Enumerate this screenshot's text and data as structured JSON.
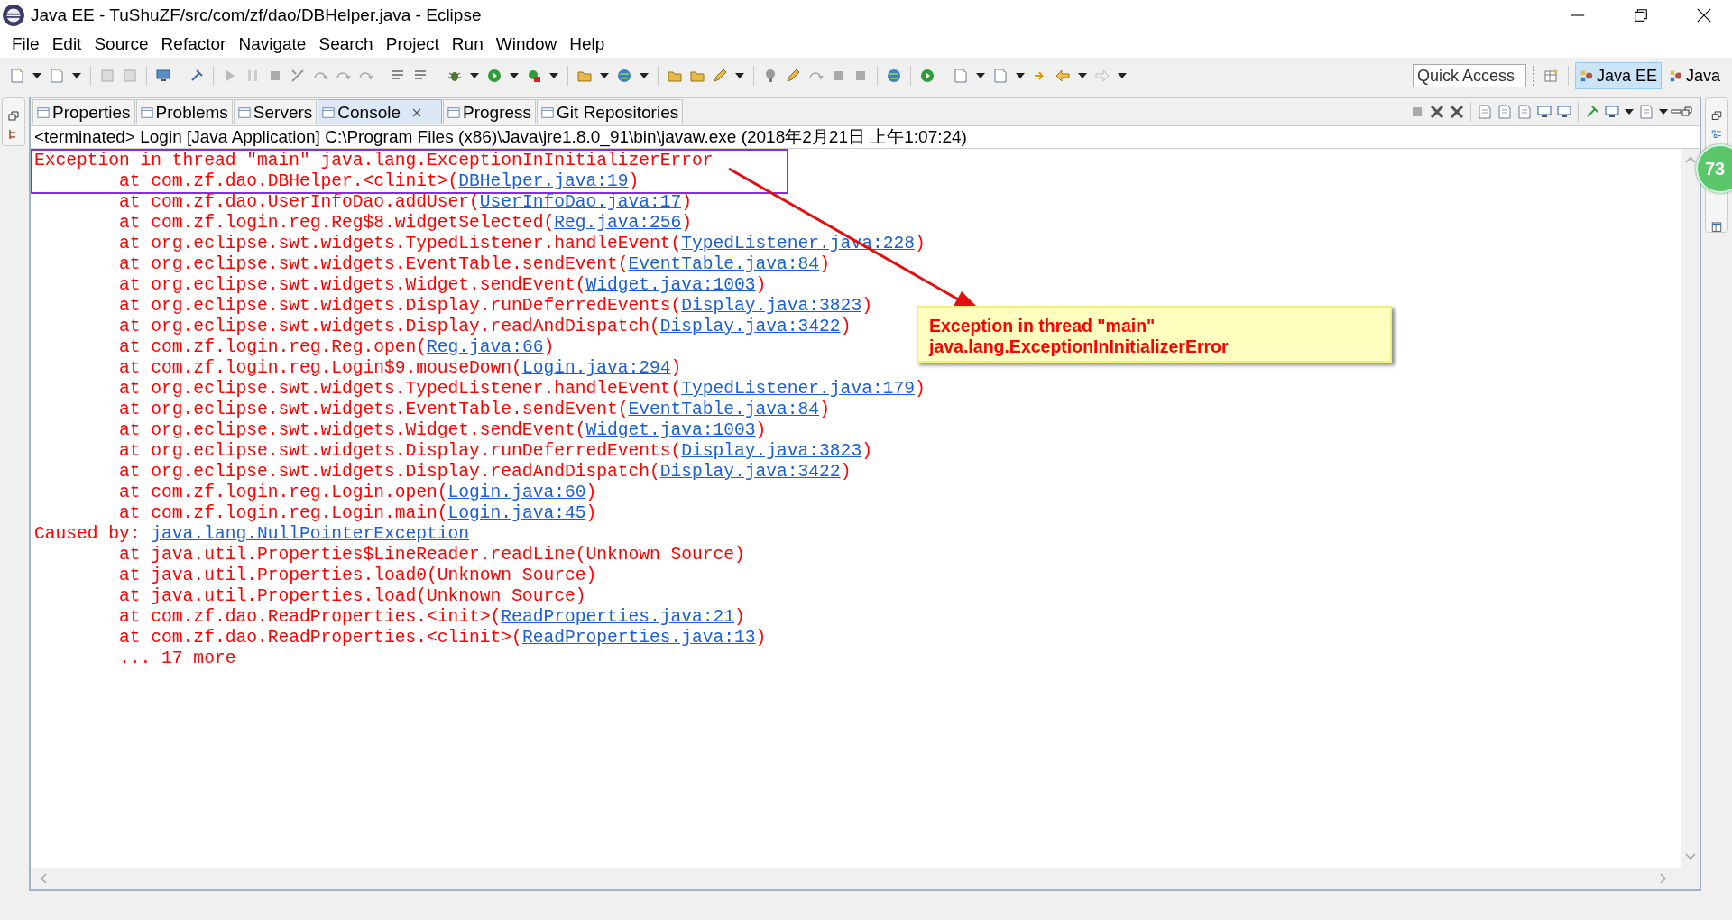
{
  "window": {
    "title": "Java EE - TuShuZF/src/com/zf/dao/DBHelper.java - Eclipse"
  },
  "menu": [
    {
      "key": "F",
      "after": "ile"
    },
    {
      "key": "E",
      "after": "dit"
    },
    {
      "key": "S",
      "after": "ource"
    },
    {
      "before": "Refac",
      "key": "t",
      "after": "or"
    },
    {
      "key": "N",
      "after": "avigate"
    },
    {
      "before": "Se",
      "key": "a",
      "after": "rch"
    },
    {
      "key": "P",
      "after": "roject"
    },
    {
      "key": "R",
      "after": "un"
    },
    {
      "key": "W",
      "after": "indow"
    },
    {
      "key": "H",
      "after": "elp"
    }
  ],
  "quick_access": {
    "placeholder": "Quick Access"
  },
  "perspectives": [
    {
      "label": "Java EE",
      "selected": true
    },
    {
      "label": "Java",
      "selected": false
    }
  ],
  "tabs": [
    {
      "label": "Properties",
      "selected": false,
      "closable": false
    },
    {
      "label": "Problems",
      "selected": false,
      "closable": false
    },
    {
      "label": "Servers",
      "selected": false,
      "closable": false
    },
    {
      "label": "Console",
      "selected": true,
      "closable": true
    },
    {
      "label": "Progress",
      "selected": false,
      "closable": false
    },
    {
      "label": "Git Repositories",
      "selected": false,
      "closable": false
    }
  ],
  "console": {
    "header": "<terminated> Login [Java Application] C:\\Program Files (x86)\\Java\\jre1.8.0_91\\bin\\javaw.exe (2018年2月21日 上午1:07:24)",
    "lines": [
      {
        "kind": "error",
        "text": "Exception in thread \"main\" java.lang.ExceptionInInitializerError"
      },
      {
        "kind": "frame",
        "text": "at com.zf.dao.DBHelper.<clinit>(",
        "link": "DBHelper.java:19",
        "tail": ")"
      },
      {
        "kind": "frame",
        "text": "at com.zf.dao.UserInfoDao.addUser(",
        "link": "UserInfoDao.java:17",
        "tail": ")"
      },
      {
        "kind": "frame",
        "text": "at com.zf.login.reg.Reg$8.widgetSelected(",
        "link": "Reg.java:256",
        "tail": ")"
      },
      {
        "kind": "frame",
        "text": "at org.eclipse.swt.widgets.TypedListener.handleEvent(",
        "link": "TypedListener.java:228",
        "tail": ")"
      },
      {
        "kind": "frame",
        "text": "at org.eclipse.swt.widgets.EventTable.sendEvent(",
        "link": "EventTable.java:84",
        "tail": ")"
      },
      {
        "kind": "frame",
        "text": "at org.eclipse.swt.widgets.Widget.sendEvent(",
        "link": "Widget.java:1003",
        "tail": ")"
      },
      {
        "kind": "frame",
        "text": "at org.eclipse.swt.widgets.Display.runDeferredEvents(",
        "link": "Display.java:3823",
        "tail": ")"
      },
      {
        "kind": "frame",
        "text": "at org.eclipse.swt.widgets.Display.readAndDispatch(",
        "link": "Display.java:3422",
        "tail": ")"
      },
      {
        "kind": "frame",
        "text": "at com.zf.login.reg.Reg.open(",
        "link": "Reg.java:66",
        "tail": ")"
      },
      {
        "kind": "frame",
        "text": "at com.zf.login.reg.Login$9.mouseDown(",
        "link": "Login.java:294",
        "tail": ")"
      },
      {
        "kind": "frame",
        "text": "at org.eclipse.swt.widgets.TypedListener.handleEvent(",
        "link": "TypedListener.java:179",
        "tail": ")"
      },
      {
        "kind": "frame",
        "text": "at org.eclipse.swt.widgets.EventTable.sendEvent(",
        "link": "EventTable.java:84",
        "tail": ")"
      },
      {
        "kind": "frame",
        "text": "at org.eclipse.swt.widgets.Widget.sendEvent(",
        "link": "Widget.java:1003",
        "tail": ")"
      },
      {
        "kind": "frame",
        "text": "at org.eclipse.swt.widgets.Display.runDeferredEvents(",
        "link": "Display.java:3823",
        "tail": ")"
      },
      {
        "kind": "frame",
        "text": "at org.eclipse.swt.widgets.Display.readAndDispatch(",
        "link": "Display.java:3422",
        "tail": ")"
      },
      {
        "kind": "frame",
        "text": "at com.zf.login.reg.Login.open(",
        "link": "Login.java:60",
        "tail": ")"
      },
      {
        "kind": "frame",
        "text": "at com.zf.login.reg.Login.main(",
        "link": "Login.java:45",
        "tail": ")"
      },
      {
        "kind": "caused",
        "text": "Caused by: ",
        "link": "java.lang.NullPointerException"
      },
      {
        "kind": "frame",
        "text": "at java.util.Properties$LineReader.readLine(Unknown Source)"
      },
      {
        "kind": "frame",
        "text": "at java.util.Properties.load0(Unknown Source)"
      },
      {
        "kind": "frame",
        "text": "at java.util.Properties.load(Unknown Source)"
      },
      {
        "kind": "frame",
        "text": "at com.zf.dao.ReadProperties.<init>(",
        "link": "ReadProperties.java:21",
        "tail": ")"
      },
      {
        "kind": "frame",
        "text": "at com.zf.dao.ReadProperties.<clinit>(",
        "link": "ReadProperties.java:13",
        "tail": ")"
      },
      {
        "kind": "more",
        "text": "... 17 more"
      }
    ]
  },
  "callout": {
    "lines": [
      "Exception in thread \"main\"",
      "java.lang.ExceptionInInitializerError"
    ]
  },
  "floating_badge": {
    "text": "73"
  }
}
